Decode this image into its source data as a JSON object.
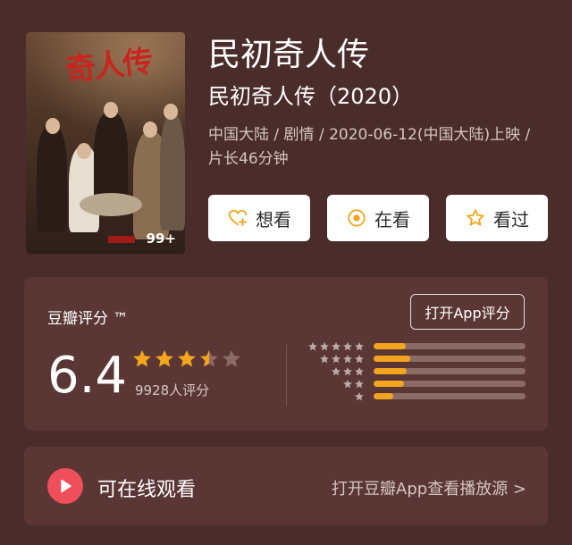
{
  "movie": {
    "title": "民初奇人传",
    "subtitle": "民初奇人传（2020）",
    "meta": "中国大陆 / 剧情 / 2020-06-12(中国大陆)上映 / 片长46分钟",
    "poster_title": "奇人传",
    "poster_badge": "99+"
  },
  "actions": [
    {
      "label": "想看",
      "icon": "heart-plus-icon"
    },
    {
      "label": "在看",
      "icon": "circle-dot-icon"
    },
    {
      "label": "看过",
      "icon": "star-outline-icon"
    }
  ],
  "rating": {
    "label": "豆瓣评分 ™",
    "open_app": "打开App评分",
    "score": "6.4",
    "star_value": 3.5,
    "count": "9928人评分",
    "distribution": [
      {
        "stars": 5,
        "fraction": 0.21
      },
      {
        "stars": 4,
        "fraction": 0.24
      },
      {
        "stars": 3,
        "fraction": 0.22
      },
      {
        "stars": 2,
        "fraction": 0.2
      },
      {
        "stars": 1,
        "fraction": 0.13
      }
    ]
  },
  "watch": {
    "label": "可在线观看",
    "link": "打开豆瓣App查看播放源 >"
  },
  "colors": {
    "background": "#4a2c2a",
    "card": "#5a3735",
    "accent": "#f3a51d",
    "play": "#ee4f5a"
  }
}
